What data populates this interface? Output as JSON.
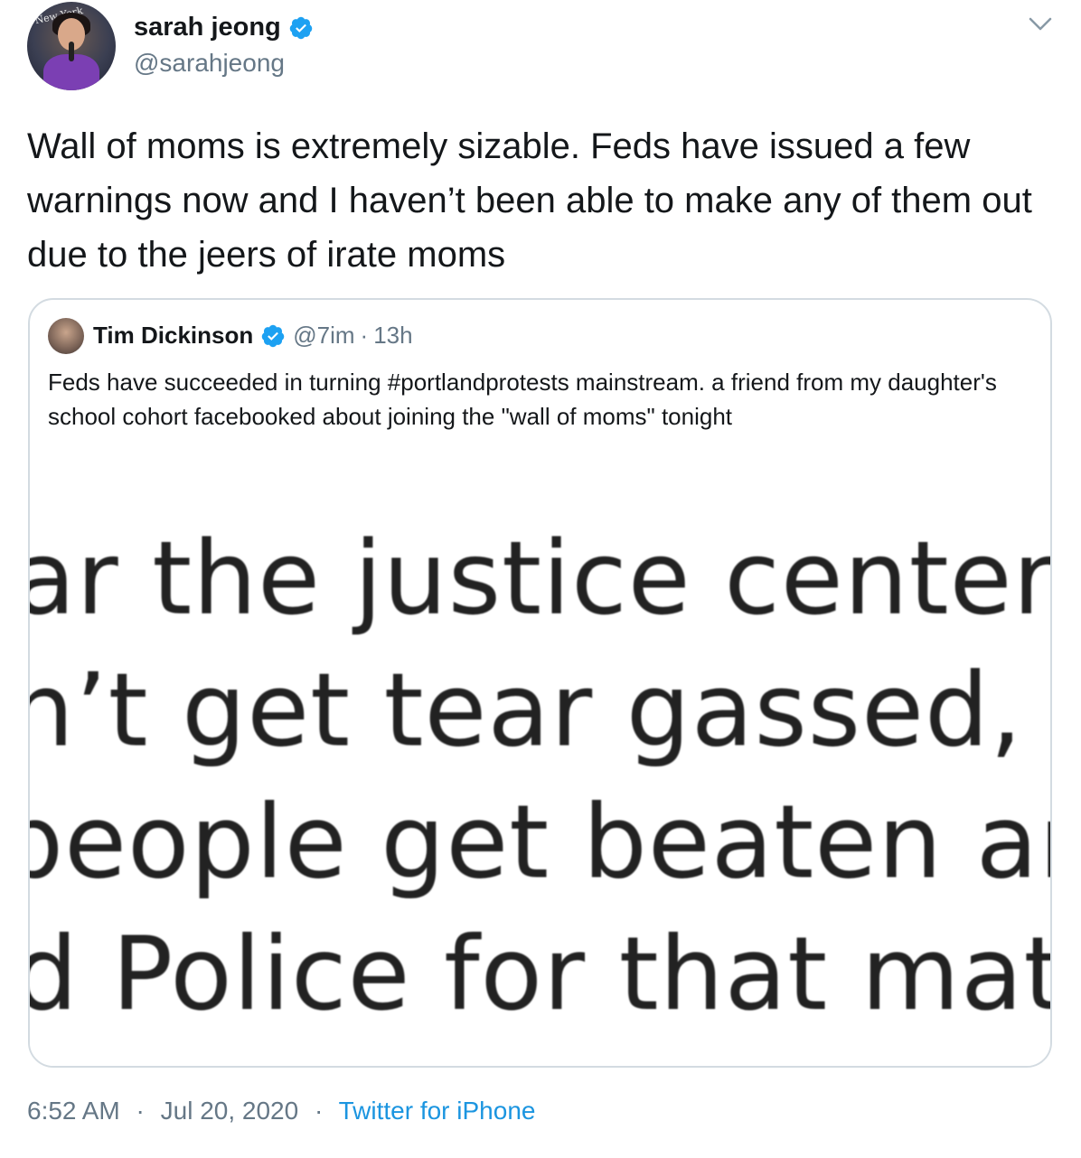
{
  "author": {
    "name": "sarah jeong",
    "handle": "@sarahjeong",
    "avatar_sign": "New York"
  },
  "tweet": {
    "text": "Wall of moms is extremely sizable. Feds have issued a few warnings now and I haven’t been able to make any of them out due to the jeers of irate moms"
  },
  "quoted": {
    "name": "Tim Dickinson",
    "handle": "@7im",
    "separator": "·",
    "time": "13h",
    "text": "Feds have succeeded in turning #portlandprotests mainstream. a friend from my daughter's school cohort facebooked about joining the \"wall of moms\" tonight",
    "image_lines": [
      "ar the justice center. I’m",
      "n’t get tear gassed, but",
      "people get beaten and",
      "d Police for that matter"
    ]
  },
  "footer": {
    "time": "6:52 AM",
    "separator": "·",
    "date": "Jul 20, 2020",
    "source": "Twitter for iPhone"
  },
  "colors": {
    "link_blue": "#1b95e0",
    "verified_blue": "#1da1f2",
    "secondary_text": "#657786",
    "border": "#d3dbe1"
  },
  "icons": {
    "verified": "verified-badge-icon",
    "menu": "chevron-down-icon"
  }
}
